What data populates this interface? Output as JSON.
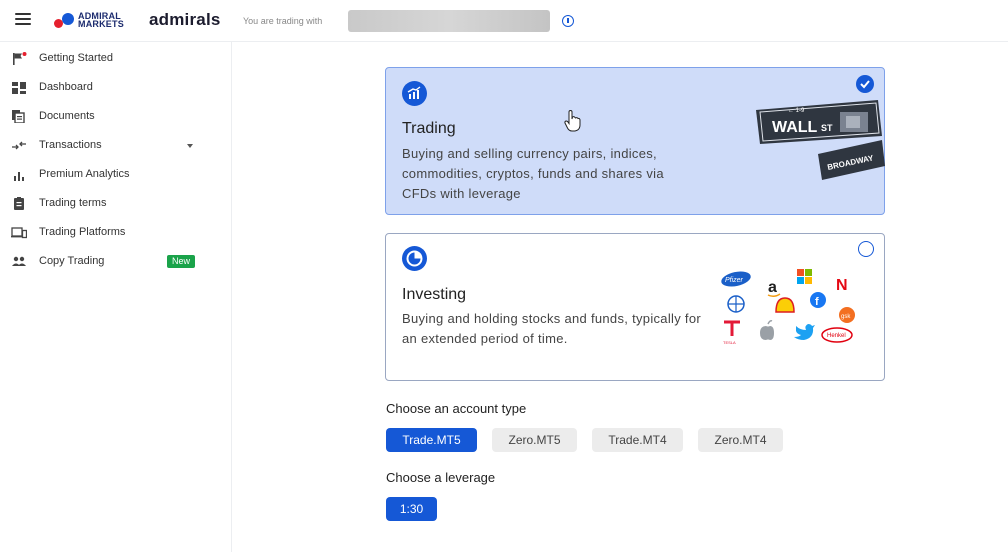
{
  "header": {
    "logo_text_line1": "ADMIRAL",
    "logo_text_line2": "MARKETS",
    "brand": "admirals",
    "trading_with_label": "You are trading with"
  },
  "sidebar": {
    "items": [
      {
        "label": "Getting Started",
        "icon": "flag-icon"
      },
      {
        "label": "Dashboard",
        "icon": "dashboard-icon"
      },
      {
        "label": "Documents",
        "icon": "documents-icon"
      },
      {
        "label": "Transactions",
        "icon": "transfer-icon",
        "has_dropdown": true
      },
      {
        "label": "Premium Analytics",
        "icon": "bar-chart-icon"
      },
      {
        "label": "Trading terms",
        "icon": "clipboard-icon"
      },
      {
        "label": "Trading Platforms",
        "icon": "devices-icon"
      },
      {
        "label": "Copy Trading",
        "icon": "people-icon",
        "badge": "New"
      }
    ]
  },
  "cards": {
    "trading": {
      "title": "Trading",
      "description": "Buying and selling currency pairs, indices, commodities, cryptos, funds and shares via CFDs with leverage",
      "selected": true,
      "sign_text_main": "WALL",
      "sign_text_st": "ST",
      "sign_text_numbers": "← 1-9",
      "sign_text_broadway": "BROADWAY"
    },
    "investing": {
      "title": "Investing",
      "description": "Buying and holding stocks and funds, typically for an extended period of time.",
      "selected": false,
      "logos": {
        "pfizer": "Pfizer",
        "amazon": "a",
        "netflix": "N",
        "tesla_caption": "TESLA",
        "henkel": "Henkel",
        "gsk": "gsk"
      }
    }
  },
  "account_type": {
    "label": "Choose an account type",
    "options": [
      "Trade.MT5",
      "Zero.MT5",
      "Trade.MT4",
      "Zero.MT4"
    ],
    "selected": "Trade.MT5"
  },
  "leverage": {
    "label": "Choose a leverage",
    "options": [
      "1:30"
    ],
    "selected": "1:30"
  },
  "colors": {
    "accent": "#1558d6",
    "selected_card_bg": "#cfdcf9",
    "badge_green": "#1aa34a"
  }
}
